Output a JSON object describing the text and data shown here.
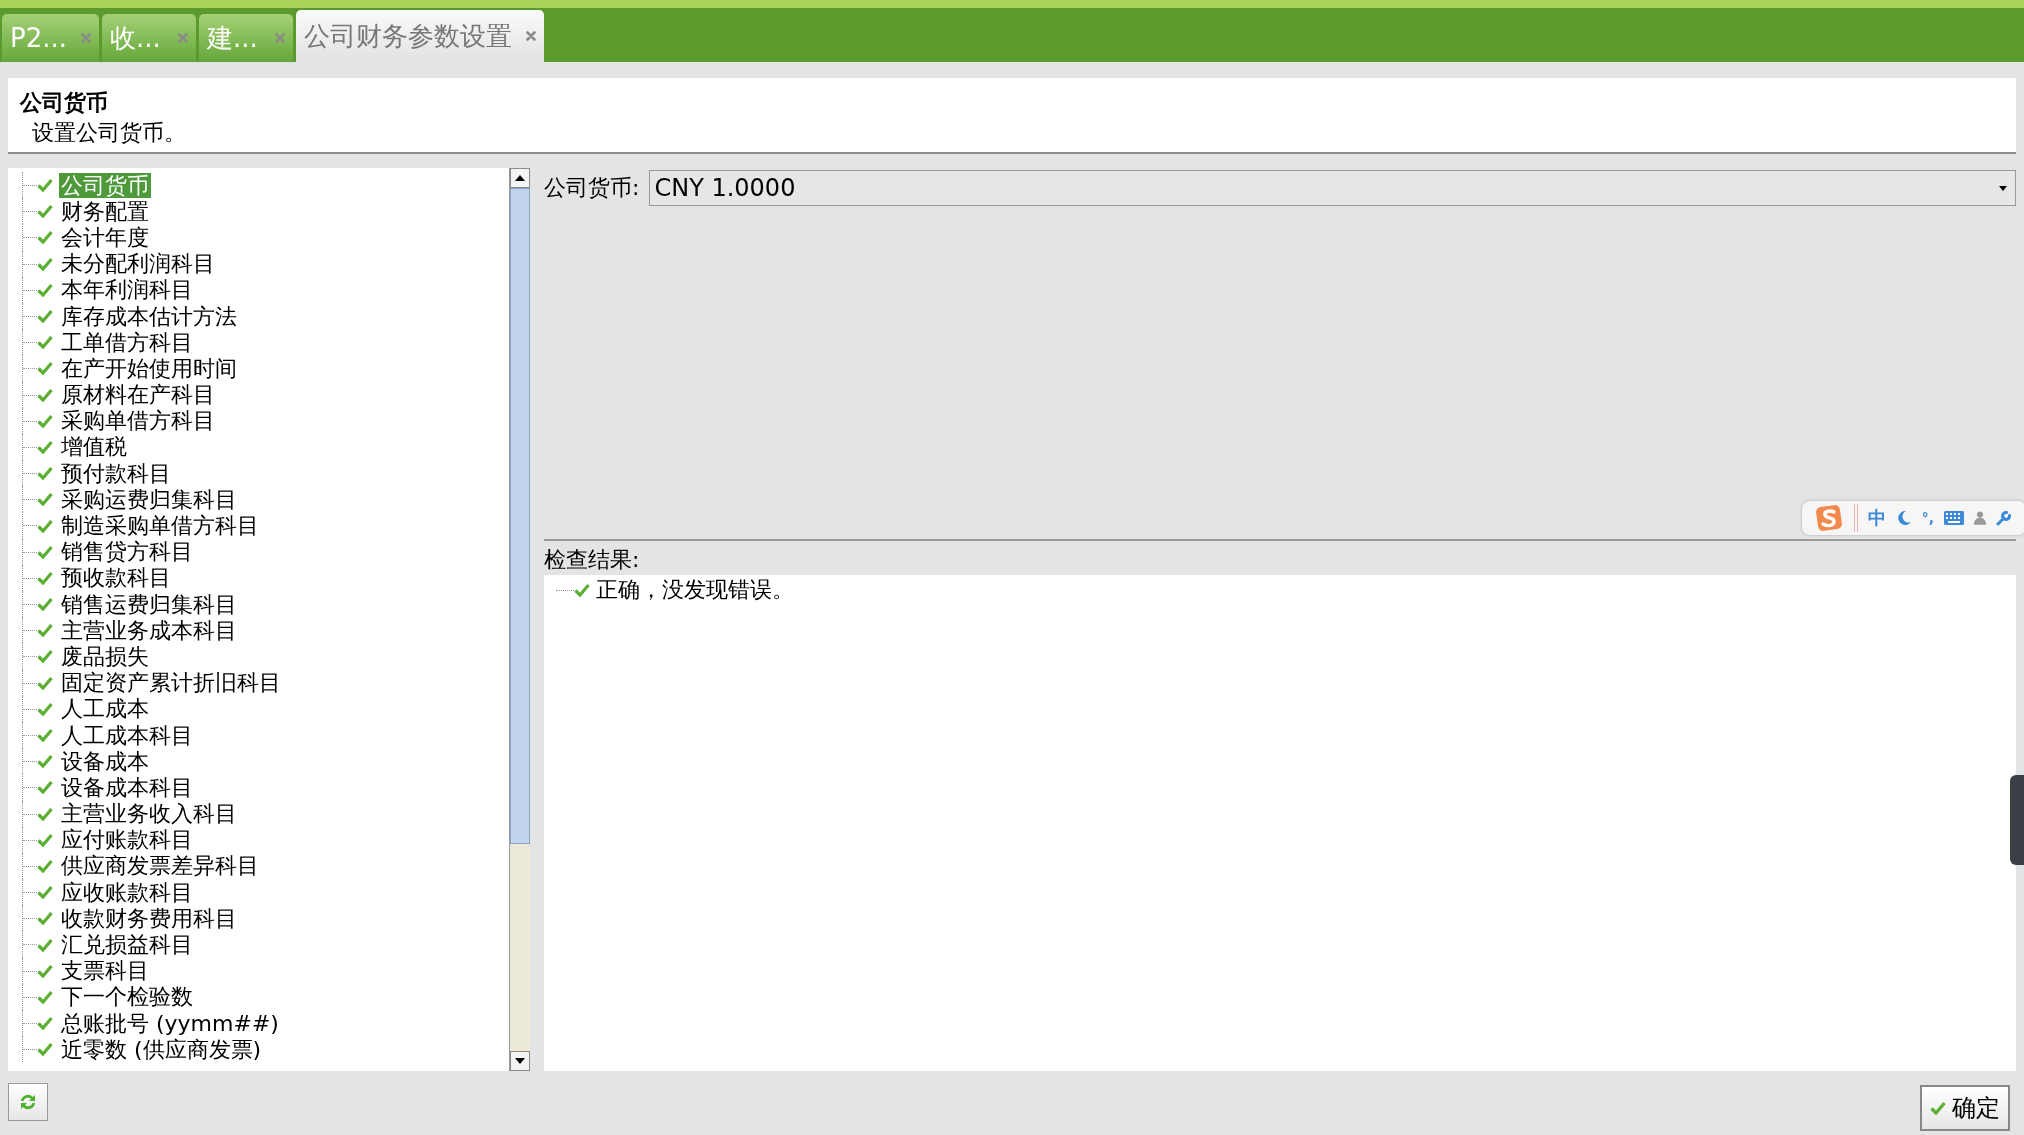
{
  "tabs": [
    {
      "label": "P2...",
      "selected": false
    },
    {
      "label": "收...",
      "selected": false
    },
    {
      "label": "建...",
      "selected": false
    },
    {
      "label": "公司财务参数设置",
      "selected": true
    }
  ],
  "header": {
    "title": "公司货币",
    "description": "设置公司货币。"
  },
  "tree": {
    "items": [
      {
        "label": "公司货币",
        "checked": true,
        "selected": true
      },
      {
        "label": "财务配置",
        "checked": true,
        "selected": false
      },
      {
        "label": "会计年度",
        "checked": true,
        "selected": false
      },
      {
        "label": "未分配利润科目",
        "checked": true,
        "selected": false
      },
      {
        "label": "本年利润科目",
        "checked": true,
        "selected": false
      },
      {
        "label": "库存成本估计方法",
        "checked": true,
        "selected": false
      },
      {
        "label": "工单借方科目",
        "checked": true,
        "selected": false
      },
      {
        "label": "在产开始使用时间",
        "checked": true,
        "selected": false
      },
      {
        "label": "原材料在产科目",
        "checked": true,
        "selected": false
      },
      {
        "label": "采购单借方科目",
        "checked": true,
        "selected": false
      },
      {
        "label": "增值税",
        "checked": true,
        "selected": false
      },
      {
        "label": "预付款科目",
        "checked": true,
        "selected": false
      },
      {
        "label": "采购运费归集科目",
        "checked": true,
        "selected": false
      },
      {
        "label": "制造采购单借方科目",
        "checked": true,
        "selected": false
      },
      {
        "label": "销售贷方科目",
        "checked": true,
        "selected": false
      },
      {
        "label": "预收款科目",
        "checked": true,
        "selected": false
      },
      {
        "label": "销售运费归集科目",
        "checked": true,
        "selected": false
      },
      {
        "label": "主营业务成本科目",
        "checked": true,
        "selected": false
      },
      {
        "label": "废品损失",
        "checked": true,
        "selected": false
      },
      {
        "label": "固定资产累计折旧科目",
        "checked": true,
        "selected": false
      },
      {
        "label": "人工成本",
        "checked": true,
        "selected": false
      },
      {
        "label": "人工成本科目",
        "checked": true,
        "selected": false
      },
      {
        "label": "设备成本",
        "checked": true,
        "selected": false
      },
      {
        "label": "设备成本科目",
        "checked": true,
        "selected": false
      },
      {
        "label": "主营业务收入科目",
        "checked": true,
        "selected": false
      },
      {
        "label": "应付账款科目",
        "checked": true,
        "selected": false
      },
      {
        "label": "供应商发票差异科目",
        "checked": true,
        "selected": false
      },
      {
        "label": "应收账款科目",
        "checked": true,
        "selected": false
      },
      {
        "label": "收款财务费用科目",
        "checked": true,
        "selected": false
      },
      {
        "label": "汇兑损益科目",
        "checked": true,
        "selected": false
      },
      {
        "label": "支票科目",
        "checked": true,
        "selected": false
      },
      {
        "label": "下一个检验数",
        "checked": true,
        "selected": false
      },
      {
        "label": "总账批号 (yymm##)",
        "checked": true,
        "selected": false
      },
      {
        "label": "近零数 (供应商发票)",
        "checked": true,
        "selected": false
      }
    ]
  },
  "currency_field": {
    "label": "公司货币:",
    "value": "CNY 1.0000"
  },
  "ime_toolbar": {
    "mode": "中",
    "punctuation": "°,"
  },
  "check_results": {
    "label": "检查结果:",
    "items": [
      {
        "text": "正确，没发现错误。",
        "ok": true
      }
    ]
  },
  "confirm_button": {
    "label": "确定"
  }
}
